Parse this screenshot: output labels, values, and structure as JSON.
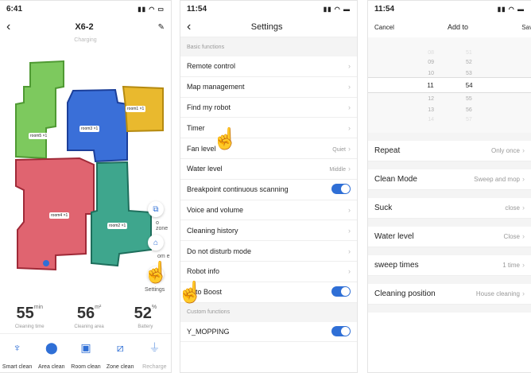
{
  "panel1": {
    "time": "6:41",
    "title": "X6-2",
    "subtitle": "Charging",
    "rooms": [
      "room1",
      "room2",
      "room3",
      "room4",
      "room5"
    ],
    "room_suffix": "×1",
    "side_labels": {
      "zone": "o zone",
      "room": "om e",
      "settings": "Settings"
    },
    "stats": [
      {
        "num": "55",
        "unit": "min",
        "label": "Cleaning time"
      },
      {
        "num": "56",
        "unit": "m²",
        "label": "Cleaning area"
      },
      {
        "num": "52",
        "unit": "%",
        "label": "Battery"
      }
    ],
    "bottom": [
      "Smart clean",
      "Area clean",
      "Room clean",
      "Zone clean",
      "Recharge"
    ]
  },
  "panel2": {
    "time": "11:54",
    "title": "Settings",
    "section1": "Basic functions",
    "rows": [
      {
        "label": "Remote control",
        "value": ""
      },
      {
        "label": "Map management",
        "value": ""
      },
      {
        "label": "Find my robot",
        "value": ""
      },
      {
        "label": "Timer",
        "value": ""
      },
      {
        "label": "Fan level",
        "value": "Quiet"
      },
      {
        "label": "Water level",
        "value": "Middle"
      },
      {
        "label": "Breakpoint continuous scanning",
        "value": "",
        "toggle": true
      },
      {
        "label": "Voice and volume",
        "value": ""
      },
      {
        "label": "Cleaning history",
        "value": ""
      },
      {
        "label": "Do not disturb mode",
        "value": ""
      },
      {
        "label": "Robot info",
        "value": ""
      },
      {
        "label": "Auto Boost",
        "value": "",
        "toggle": true
      }
    ],
    "section2": "Custom functions",
    "custom_row": "Y_MOPPING"
  },
  "panel3": {
    "time": "11:54",
    "cancel": "Cancel",
    "title": "Add to",
    "save": "Sav",
    "picker": {
      "hours": [
        "08",
        "09",
        "10",
        "11",
        "12",
        "13",
        "14"
      ],
      "minutes": [
        "51",
        "52",
        "53",
        "54",
        "55",
        "56",
        "57"
      ]
    },
    "rows": [
      {
        "label": "Repeat",
        "value": "Only once"
      },
      {
        "label": "Clean Mode",
        "value": "Sweep and mop"
      },
      {
        "label": "Suck",
        "value": "close"
      },
      {
        "label": "Water level",
        "value": "Close"
      },
      {
        "label": "sweep times",
        "value": "1 time"
      },
      {
        "label": "Cleaning position",
        "value": "House cleaning"
      }
    ]
  },
  "colors": {
    "accent": "#2f6fd6",
    "room_green": "#7dc95e",
    "room_blue": "#3a6fd8",
    "room_yellow": "#e9b92e",
    "room_red": "#e06470",
    "room_teal": "#3ea68d"
  }
}
